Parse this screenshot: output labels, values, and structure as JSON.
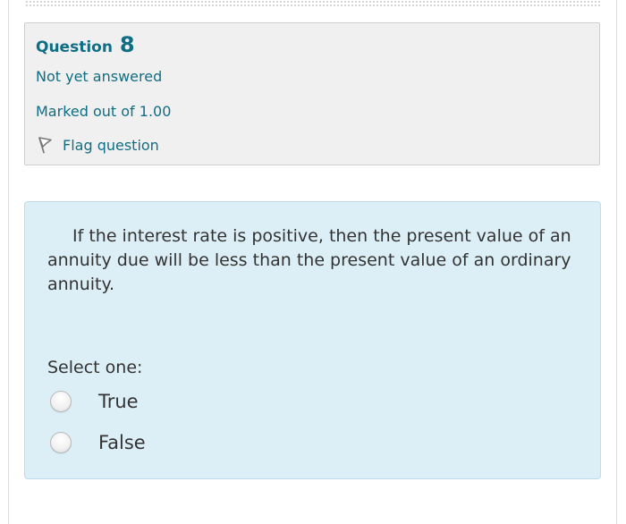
{
  "question_info": {
    "title_prefix": "Question",
    "number": "8",
    "state": "Not yet answered",
    "grade": "Marked out of 1.00",
    "flag_label": "Flag question"
  },
  "question": {
    "text": "If the interest rate is positive, then the present value of an annuity due will be less than the present value of an ordinary annuity.",
    "prompt": "Select one:",
    "options": [
      {
        "label": "True",
        "selected": false
      },
      {
        "label": "False",
        "selected": false
      }
    ]
  },
  "colors": {
    "accent": "#0f6e84",
    "info_background": "#f0f0f0",
    "content_background": "#dceff7",
    "text": "#333333"
  },
  "icons": {
    "flag": "flag-icon",
    "radio": "radio-button"
  }
}
